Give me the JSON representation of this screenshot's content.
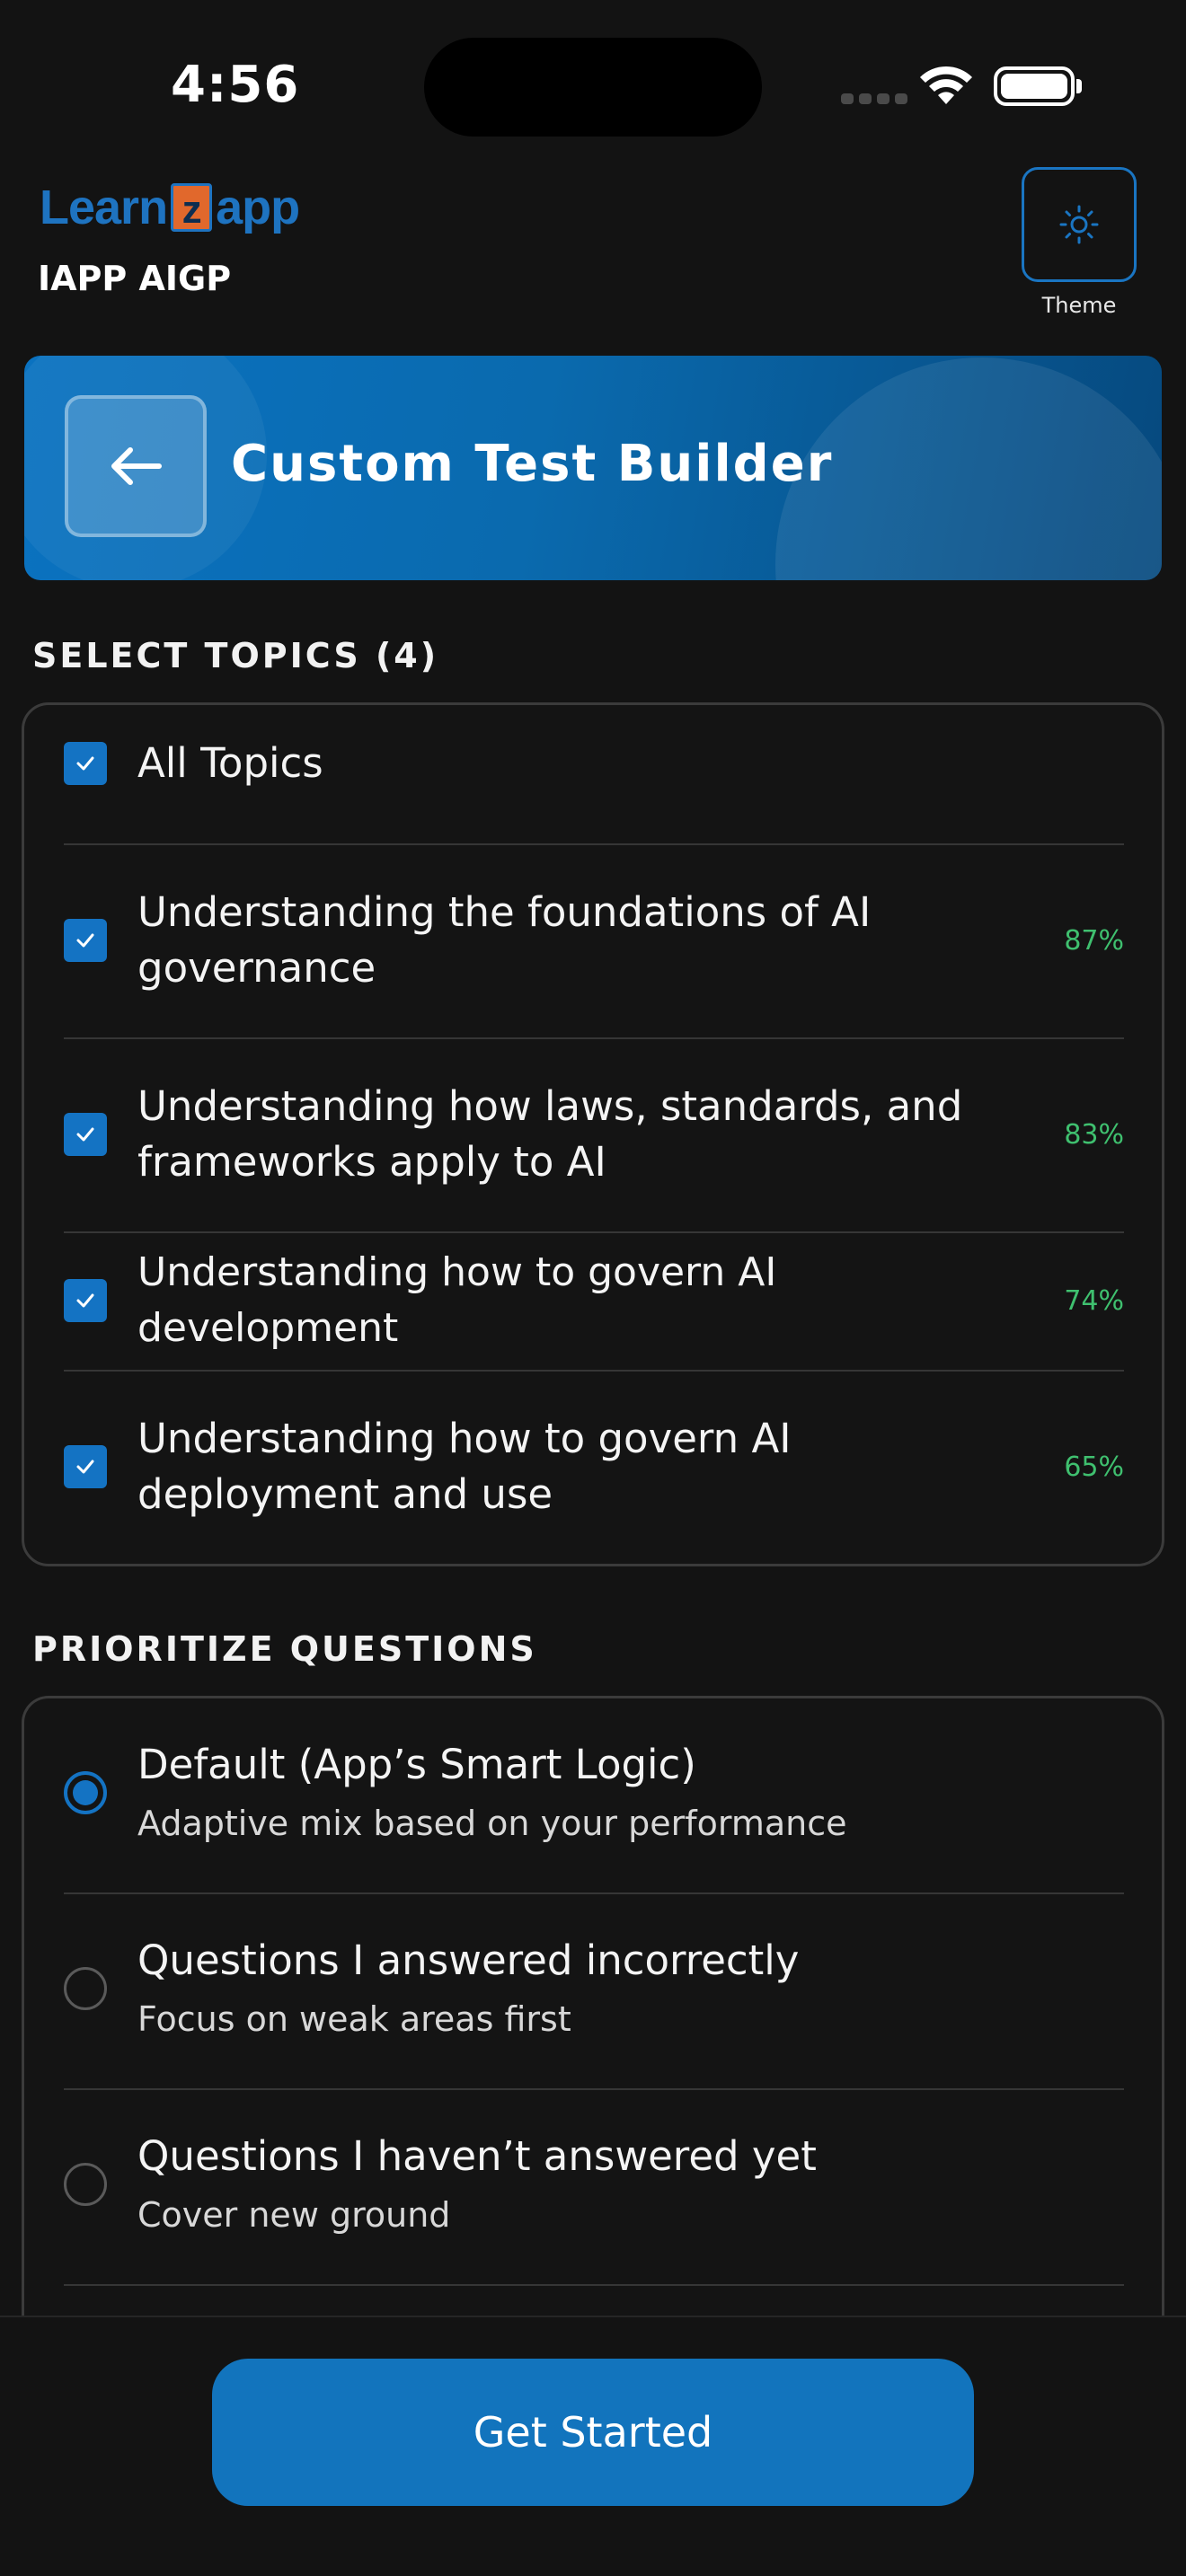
{
  "status_bar": {
    "time": "4:56"
  },
  "header": {
    "logo_left": "Learn",
    "logo_z": "z",
    "logo_right": "app",
    "app_subtitle": "IAPP AIGP",
    "theme_label": "Theme",
    "theme_icon": "sun-icon"
  },
  "banner": {
    "title": "Custom Test Builder",
    "back_icon": "arrow-left-icon"
  },
  "topics": {
    "section_label": "SELECT TOPICS (4)",
    "all_label": "All Topics",
    "items": [
      {
        "label": "Understanding the foundations of AI governance",
        "percent": "87%",
        "checked": true
      },
      {
        "label": "Understanding how laws, standards, and frameworks apply to AI",
        "percent": "83%",
        "checked": true
      },
      {
        "label": "Understanding how to govern AI development",
        "percent": "74%",
        "checked": true
      },
      {
        "label": "Understanding how to govern AI deployment and use",
        "percent": "65%",
        "checked": true
      }
    ]
  },
  "prioritize": {
    "section_label": "PRIORITIZE QUESTIONS",
    "options": [
      {
        "title": "Default (App’s Smart Logic)",
        "subtitle": "Adaptive mix based on your performance",
        "selected": true
      },
      {
        "title": "Questions I answered incorrectly",
        "subtitle": "Focus on weak areas first",
        "selected": false
      },
      {
        "title": "Questions I haven’t answered yet",
        "subtitle": "Cover new ground",
        "selected": false
      }
    ]
  },
  "cta": {
    "label": "Get Started"
  },
  "colors": {
    "accent": "#1473c3",
    "success": "#3fc06f",
    "background": "#131313"
  }
}
